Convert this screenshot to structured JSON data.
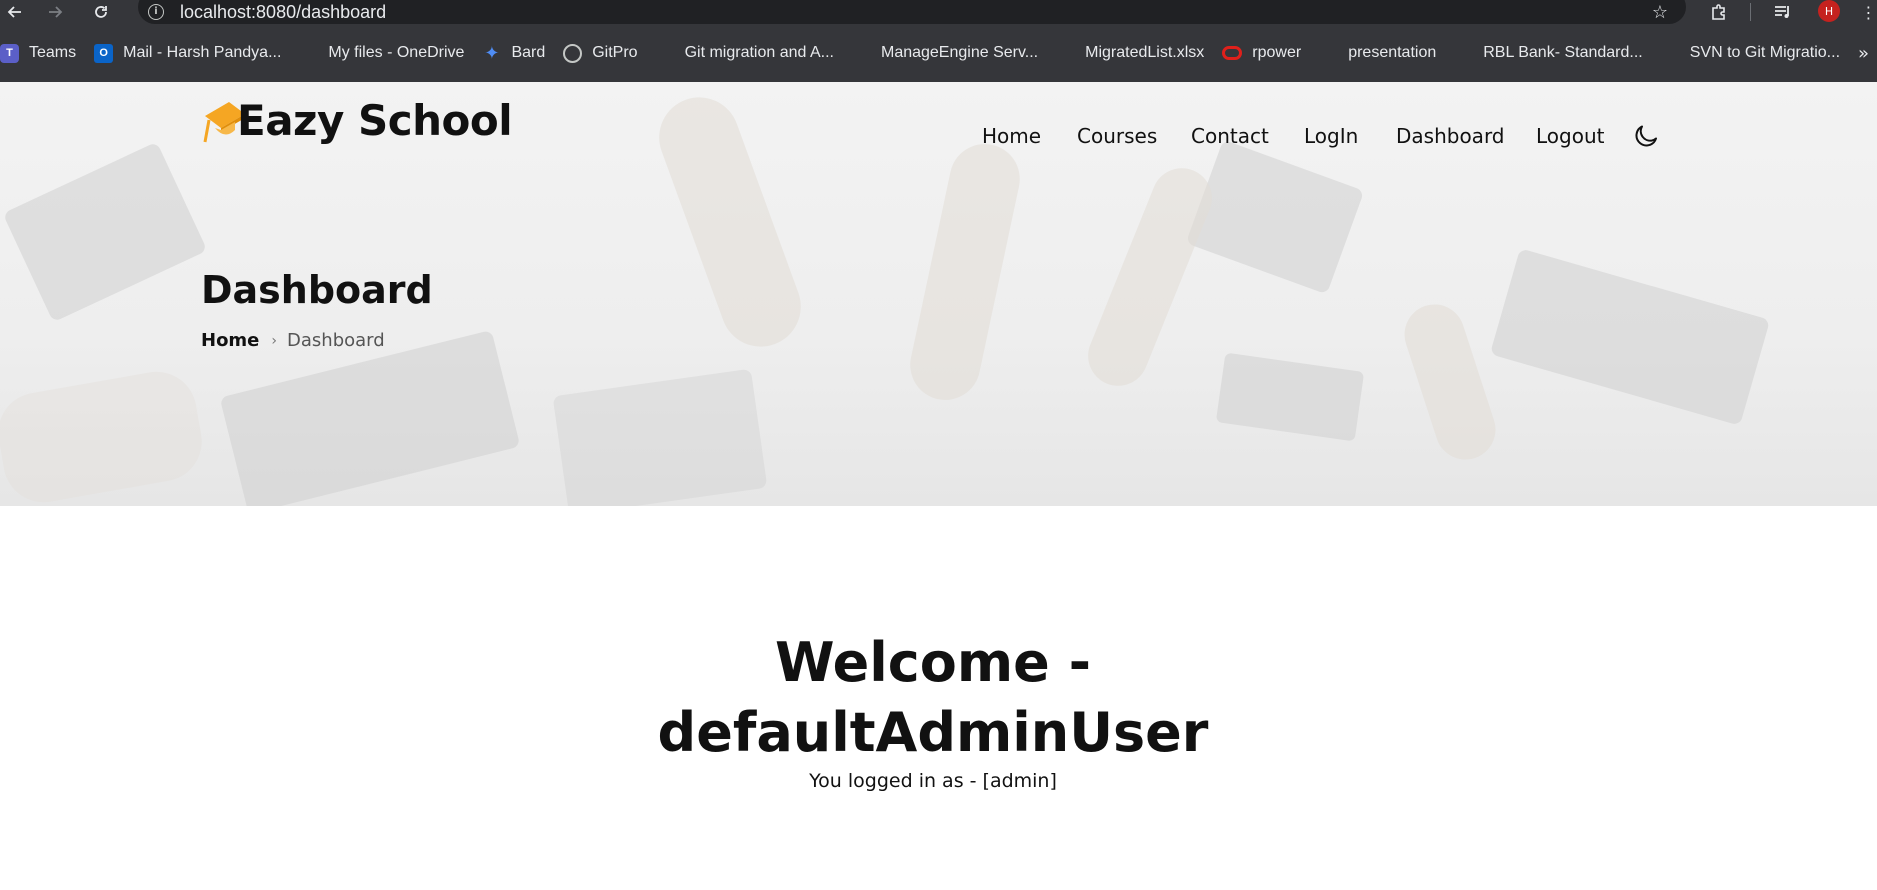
{
  "browser": {
    "url": "localhost:8080/dashboard",
    "profile_initial": "H",
    "icons": {
      "back": "arrow-left-icon",
      "forward": "arrow-right-icon",
      "reload": "reload-icon",
      "site_info": "info-icon",
      "bookmark_star": "star-icon",
      "extensions": "puzzle-icon",
      "media": "queue-music-icon",
      "menu": "kebab-icon"
    },
    "bookmarks": [
      {
        "label": "Teams",
        "icon": "teams"
      },
      {
        "label": "Mail - Harsh Pandya...",
        "icon": "outlook"
      },
      {
        "label": "My files - OneDrive",
        "icon": "microsoft"
      },
      {
        "label": "Bard",
        "icon": "bard"
      },
      {
        "label": "GitPro",
        "icon": "globe"
      },
      {
        "label": "Git migration and A...",
        "icon": "microsoft"
      },
      {
        "label": "ManageEngine Serv...",
        "icon": "microsoft"
      },
      {
        "label": "MigratedList.xlsx",
        "icon": "microsoft"
      },
      {
        "label": "rpower",
        "icon": "oracle"
      },
      {
        "label": "presentation",
        "icon": "microsoft"
      },
      {
        "label": "RBL Bank- Standard...",
        "icon": "microsoft"
      },
      {
        "label": "SVN to Git Migratio...",
        "icon": "microsoft"
      }
    ]
  },
  "site": {
    "brand": "Eazy School",
    "nav": [
      "Home",
      "Courses",
      "Contact",
      "LogIn",
      "Dashboard",
      "Logout"
    ],
    "theme_toggle_icon": "moon-icon",
    "accent_color": "#f5a623"
  },
  "hero": {
    "title": "Dashboard",
    "breadcrumb": {
      "home": "Home",
      "separator": "›",
      "current": "Dashboard"
    }
  },
  "main": {
    "welcome_line1": "Welcome -",
    "welcome_line2": "defaultAdminUser",
    "role_text": "You logged in as - [admin]"
  }
}
